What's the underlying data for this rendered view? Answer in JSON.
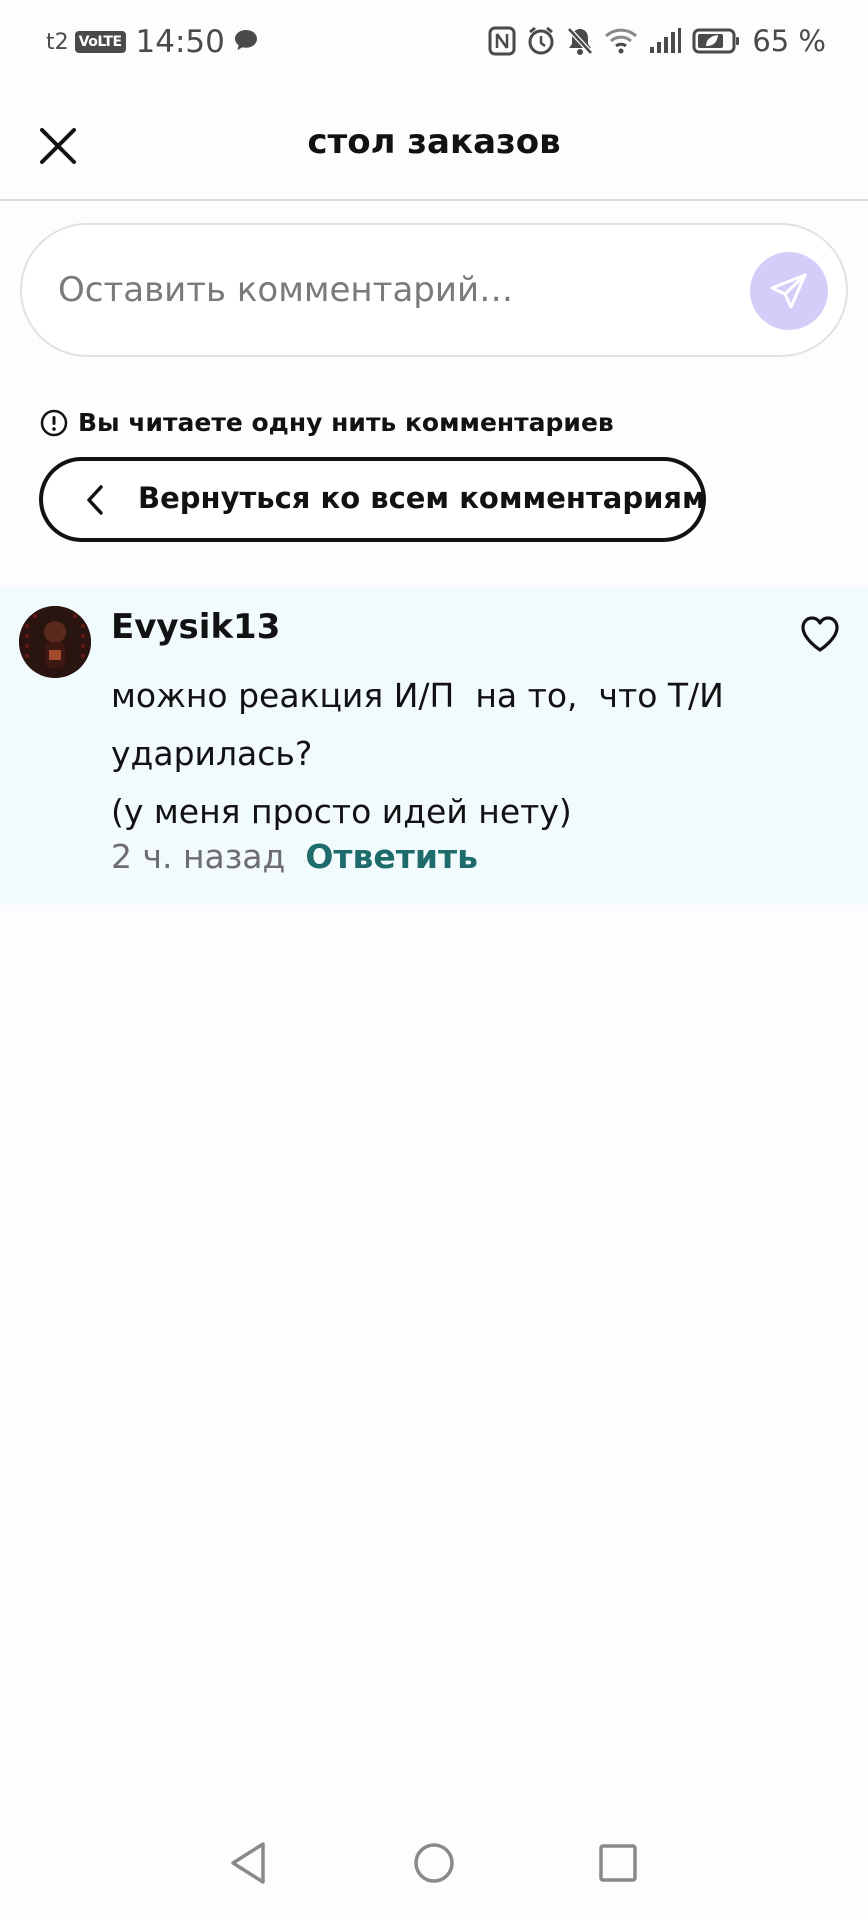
{
  "status_bar": {
    "carrier": "t2",
    "volte": "VoLTE",
    "time": "14:50",
    "battery": "65 %"
  },
  "header": {
    "title": "стол заказов"
  },
  "comment_input": {
    "placeholder": "Оставить комментарий…",
    "send_button_color": "#d6ccfa"
  },
  "thread": {
    "notice": "Вы читаете одну нить комментариев",
    "back_label": "Вернуться ко всем комментариям"
  },
  "comment": {
    "author": "Evysik13",
    "lines": [
      "можно реакция И/П  на то,  что Т/И",
      "ударилась?",
      "(у меня просто идей нету)"
    ],
    "timestamp": "2 ч. назад",
    "reply_label": "Ответить",
    "background_color": "#f1fafd",
    "reply_color": "#1d6b6b"
  },
  "icons": [
    "close-icon",
    "send-icon",
    "info-icon",
    "chevron-left-icon",
    "heart-icon",
    "nav-back-icon",
    "nav-home-icon",
    "nav-recent-icon"
  ]
}
